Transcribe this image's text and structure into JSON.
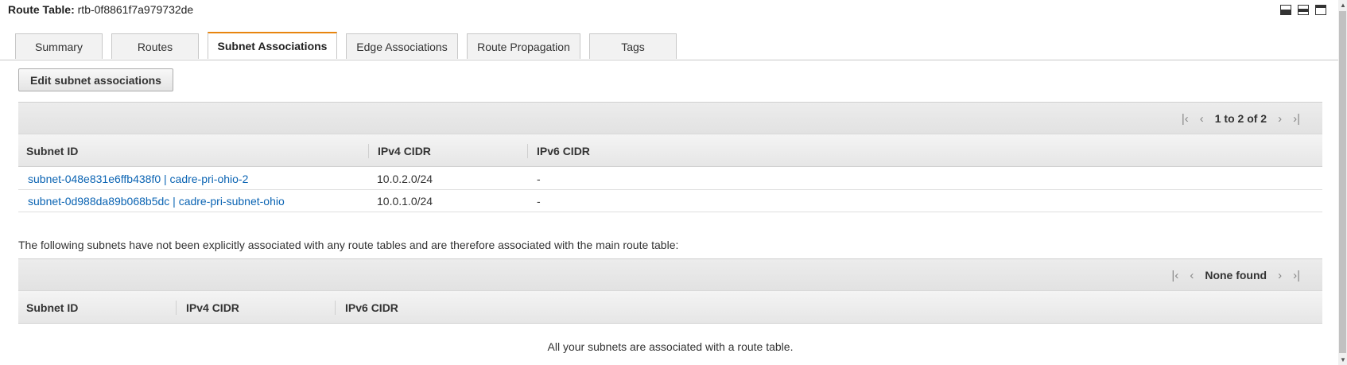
{
  "header": {
    "label": "Route Table:",
    "route_table_id": "rtb-0f8861f7a979732de"
  },
  "window_icons": [
    "panel-bottom-icon",
    "panel-split-icon",
    "panel-top-icon"
  ],
  "tabs": [
    {
      "label": "Summary",
      "active": false
    },
    {
      "label": "Routes",
      "active": false
    },
    {
      "label": "Subnet Associations",
      "active": true
    },
    {
      "label": "Edge Associations",
      "active": false
    },
    {
      "label": "Route Propagation",
      "active": false
    },
    {
      "label": "Tags",
      "active": false
    }
  ],
  "edit_button": "Edit subnet associations",
  "associated": {
    "pager_text": "1 to 2 of 2",
    "columns": [
      "Subnet ID",
      "IPv4 CIDR",
      "IPv6 CIDR"
    ],
    "rows": [
      {
        "subnet": "subnet-048e831e6ffb438f0 | cadre-pri-ohio-2",
        "ipv4": "10.0.2.0/24",
        "ipv6": "-"
      },
      {
        "subnet": "subnet-0d988da89b068b5dc | cadre-pri-subnet-ohio",
        "ipv4": "10.0.1.0/24",
        "ipv6": "-"
      }
    ]
  },
  "unassociated": {
    "note": "The following subnets have not been explicitly associated with any route tables and are therefore associated with the main route table:",
    "pager_text": "None found",
    "columns": [
      "Subnet ID",
      "IPv4 CIDR",
      "IPv6 CIDR"
    ],
    "empty_message": "All your subnets are associated with a route table."
  },
  "colors": {
    "accent_tab": "#e8850f",
    "link": "#0b64b3"
  }
}
